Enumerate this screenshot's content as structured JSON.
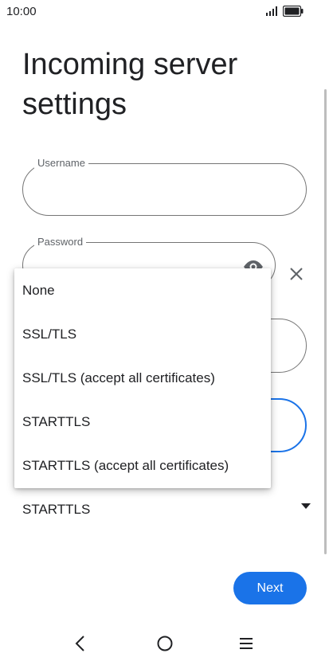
{
  "status_bar": {
    "time": "10:00",
    "icons": [
      "signal-icon",
      "battery-icon"
    ]
  },
  "page": {
    "title": "Incoming server settings"
  },
  "fields": {
    "username": {
      "label": "Username",
      "value": ""
    },
    "password": {
      "label": "Password",
      "value": ""
    }
  },
  "security": {
    "selected_value": "STARTTLS",
    "options": [
      "None",
      "SSL/TLS",
      "SSL/TLS (accept all certificates)",
      "STARTTLS",
      "STARTTLS (accept all certificates)"
    ]
  },
  "actions": {
    "next_label": "Next"
  },
  "nav_bar": {
    "icons": [
      "back-icon",
      "home-icon",
      "menu-icon"
    ]
  },
  "colors": {
    "accent": "#1a73e8",
    "outline": "#757575",
    "text": "#202124"
  }
}
